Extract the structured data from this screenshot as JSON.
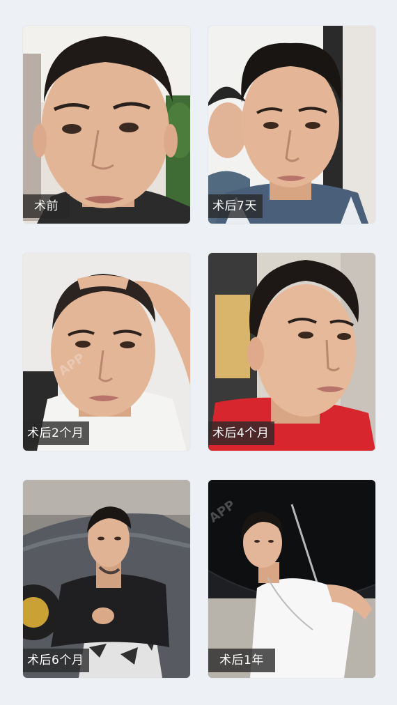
{
  "cards": [
    {
      "label": "术前"
    },
    {
      "label": "术后7天"
    },
    {
      "label": "术后2个月"
    },
    {
      "label": "术后4个月"
    },
    {
      "label": "术后6个月"
    },
    {
      "label": "术后1年"
    }
  ],
  "watermark": "APP"
}
